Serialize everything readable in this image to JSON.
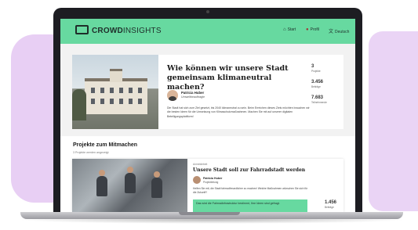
{
  "navbar": {
    "logo_bold": "CROWD",
    "logo_light": "INSIGHTS",
    "items": [
      {
        "icon": "home-icon",
        "glyph": "⌂",
        "label": "Start"
      },
      {
        "icon": "profile-icon",
        "glyph": "●",
        "label": "Profil"
      },
      {
        "icon": "language-icon",
        "glyph": "文",
        "label": "Deutsch"
      }
    ]
  },
  "hero": {
    "title": "Wie können wir unsere Stadt gemeinsam klimaneutral machen?",
    "author_name": "Patricia Huber",
    "author_role": "Umweltbeauftragte",
    "text": "Die Stadt hat sich zum Ziel gesetzt, bis 2040 klimaneutral zu sein. Beim Erreichen dieses Ziels möchten brauchen wir die besten Ideen für die Umsetzung von Klimaschutzmaßnahmen. Machen Sie mit auf unserer digitalen Beteiligungsplattform!",
    "stats": [
      {
        "value": "3",
        "label": "Projekte"
      },
      {
        "value": "3.456",
        "label": "Beiträge"
      },
      {
        "value": "7.683",
        "label": "Teilnehmende"
      }
    ]
  },
  "section": {
    "title": "Projekte zum Mitmachen",
    "subtitle": "3 Projekte werden angezeigt"
  },
  "card": {
    "date": "Anmeldebeit",
    "title": "Unsere Stadt soll zur Fahrradstadt werden",
    "author_name": "Patricia Huber",
    "author_role": "Projektleitung",
    "text": "Helfen Sie mit, die Stadt fahrradfreundlicher zu machen! Welche Maßnahmen wünschen Sie sich für die Zukunft?",
    "cta": "Das wird die Fahrradinfrastruktur bestimmt, Ihre Ideen sind gefragt.",
    "stat_value": "1.456",
    "stat_label": "Beiträge"
  },
  "colors": {
    "accent": "#67d9a0",
    "background": "#f2f2f2",
    "blob": "#e8cff4"
  }
}
